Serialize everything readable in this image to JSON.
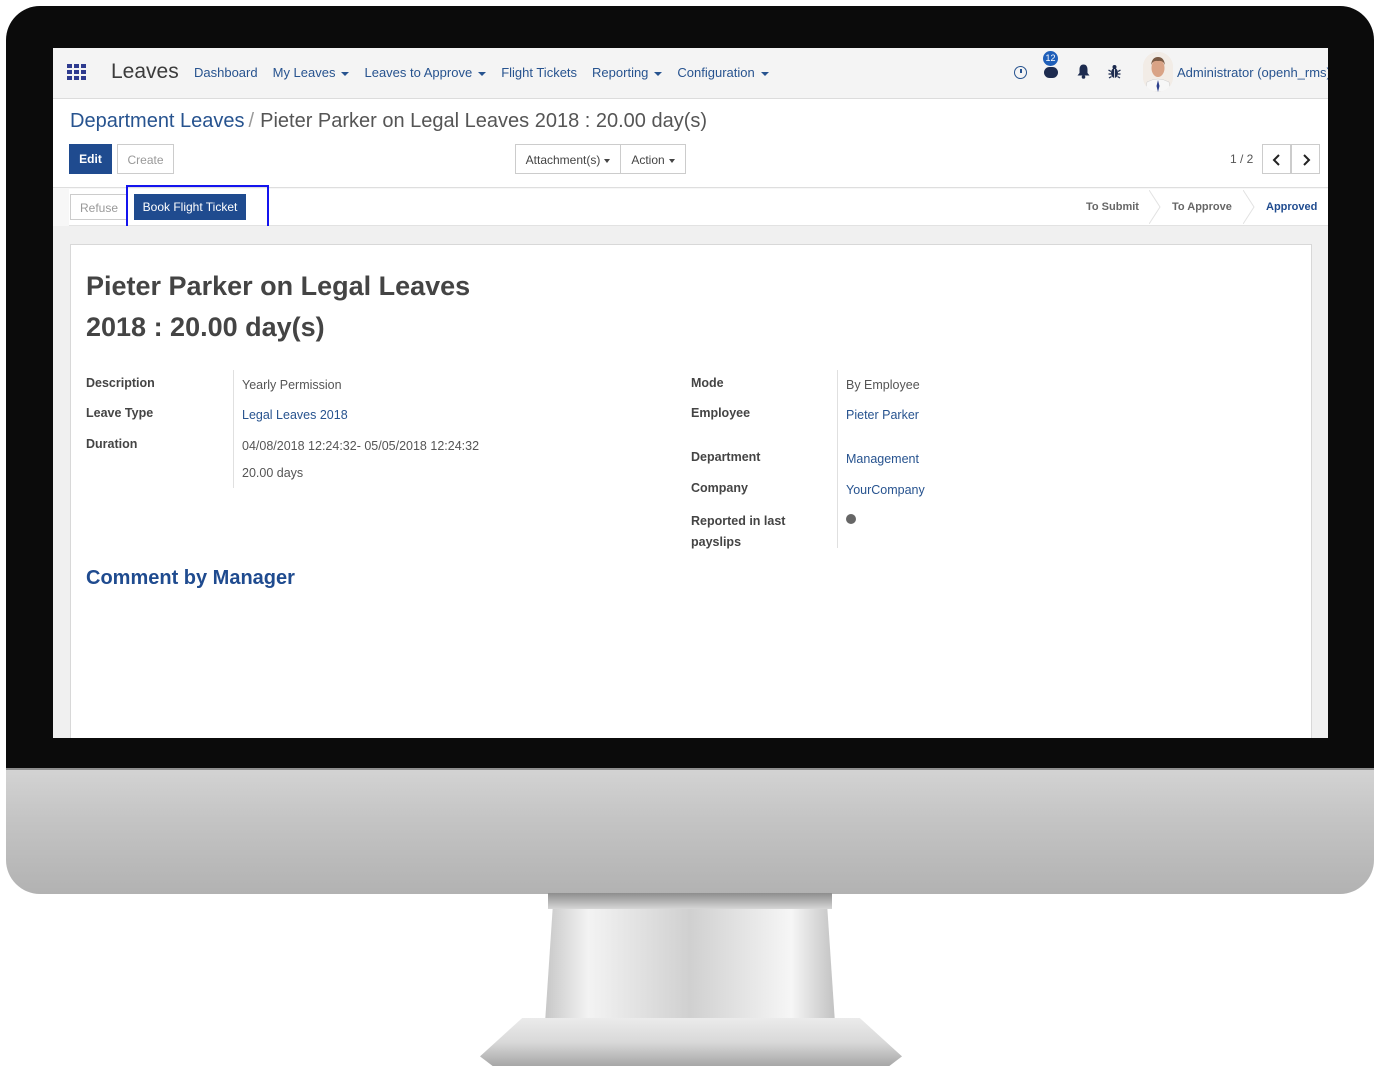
{
  "topbar": {
    "app_name": "Leaves",
    "nav": [
      "Dashboard",
      "My Leaves",
      "Leaves to Approve",
      "Flight Tickets",
      "Reporting",
      "Configuration"
    ],
    "nav_has_dropdown": [
      false,
      true,
      true,
      false,
      true,
      true
    ],
    "chat_count": "12",
    "user_name": "Administrator (openh_rms)"
  },
  "breadcrumb": {
    "parent": "Department Leaves",
    "separator": "/",
    "current": "Pieter Parker on Legal Leaves 2018 : 20.00 day(s)"
  },
  "buttons": {
    "edit": "Edit",
    "create": "Create",
    "attachments": "Attachment(s)",
    "action": "Action",
    "refuse": "Refuse",
    "book_flight": "Book Flight Ticket"
  },
  "pager": {
    "label": "1 / 2"
  },
  "stages": [
    "To Submit",
    "To Approve",
    "Approved"
  ],
  "active_stage": "Approved",
  "record": {
    "title_line1": "Pieter Parker on Legal Leaves",
    "title_line2": "2018 : 20.00 day(s)",
    "left": {
      "description_label": "Description",
      "description": "Yearly Permission",
      "leave_type_label": "Leave Type",
      "leave_type": "Legal Leaves 2018",
      "duration_label": "Duration",
      "duration_range": "04/08/2018 12:24:32- 05/05/2018 12:24:32",
      "duration_days": "20.00 days"
    },
    "right": {
      "mode_label": "Mode",
      "mode": "By Employee",
      "employee_label": "Employee",
      "employee": "Pieter Parker",
      "department_label": "Department",
      "department": "Management",
      "company_label": "Company",
      "company": "YourCompany",
      "payslips_label_line1": "Reported in last",
      "payslips_label_line2": "payslips",
      "payslips_value": false
    },
    "comment_title": "Comment by Manager"
  },
  "colors": {
    "primary": "#1f4b8f",
    "link": "#27538f",
    "highlight": "#1414ee"
  }
}
